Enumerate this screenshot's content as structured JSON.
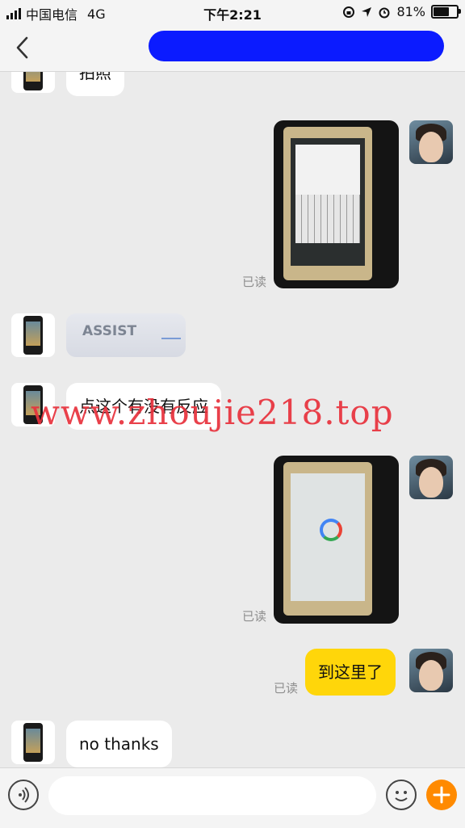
{
  "status_bar": {
    "carrier": "中国电信",
    "network": "4G",
    "time": "下午2:21",
    "battery": "81%",
    "battery_level": 0.81
  },
  "chat": {
    "messages": [
      {
        "side": "other",
        "type": "text",
        "text": "拍照"
      },
      {
        "side": "me",
        "type": "image",
        "read": "已读"
      },
      {
        "side": "other",
        "type": "image",
        "text": "ASSIST"
      },
      {
        "side": "other",
        "type": "text",
        "text": "点这个有没有反应"
      },
      {
        "side": "me",
        "type": "image",
        "read": "已读"
      },
      {
        "side": "me",
        "type": "text",
        "text": "到这里了",
        "read": "已读"
      },
      {
        "side": "other",
        "type": "text",
        "text": "no thanks"
      }
    ]
  },
  "watermark": "www.zhoujie218.top",
  "colors": {
    "accent": "#ff8a00",
    "my_bubble": "#ffd60a",
    "redaction": "#0b1bff",
    "watermark": "#e8313c"
  },
  "input_bar": {
    "placeholder": ""
  }
}
